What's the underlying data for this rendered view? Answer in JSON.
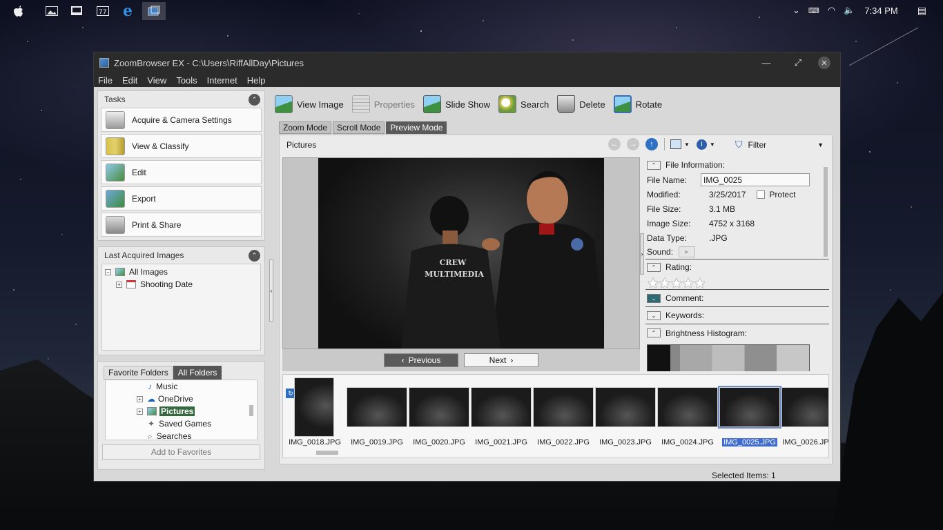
{
  "taskbar": {
    "icons": [
      "apple-icon",
      "photos-icon",
      "computer-icon",
      "calculator-icon",
      "edge-icon",
      "zoombrowser-icon"
    ],
    "time": "7:34 PM"
  },
  "window": {
    "title": "ZoomBrowser EX  -  C:\\Users\\RiffAllDay\\Pictures",
    "menu": [
      "File",
      "Edit",
      "View",
      "Tools",
      "Internet",
      "Help"
    ]
  },
  "tasks": {
    "header": "Tasks",
    "items": [
      "Acquire & Camera Settings",
      "View & Classify",
      "Edit",
      "Export",
      "Print & Share"
    ]
  },
  "last_acquired": {
    "header": "Last Acquired Images",
    "tree": [
      "All Images",
      "Shooting Date"
    ]
  },
  "folders": {
    "tabs": [
      "Favorite Folders",
      "All Folders"
    ],
    "items": [
      "Music",
      "OneDrive",
      "Pictures",
      "Saved Games",
      "Searches"
    ],
    "add_button": "Add to Favorites"
  },
  "toolbar": {
    "items": [
      "View Image",
      "Properties",
      "Slide Show",
      "Search",
      "Delete",
      "Rotate"
    ]
  },
  "mode_tabs": [
    "Zoom Mode",
    "Scroll Mode",
    "Preview Mode"
  ],
  "content": {
    "folder_label": "Pictures",
    "filter_label": "Filter",
    "previous": "Previous",
    "next": "Next"
  },
  "photo": {
    "shirt_text_line1": "CREW",
    "shirt_text_line2": "MULTIMEDIA"
  },
  "file_info": {
    "section_title": "File Information:",
    "file_name_label": "File Name:",
    "file_name": "IMG_0025",
    "modified_label": "Modified:",
    "modified": "3/25/2017",
    "protect_label": "Protect",
    "size_label": "File Size:",
    "size": "3.1 MB",
    "image_size_label": "Image Size:",
    "image_size": "4752 x 3168",
    "data_type_label": "Data Type:",
    "data_type": ".JPG",
    "sound_label": "Sound:",
    "rating_label": "Rating:",
    "rating_stars": "★★★★★",
    "comment_label": "Comment:",
    "keywords_label": "Keywords:",
    "histogram_label": "Brightness Histogram:"
  },
  "thumbnails": [
    "IMG_0018.JPG",
    "IMG_0019.JPG",
    "IMG_0020.JPG",
    "IMG_0021.JPG",
    "IMG_0022.JPG",
    "IMG_0023.JPG",
    "IMG_0024.JPG",
    "IMG_0025.JPG",
    "IMG_0026.JP"
  ],
  "status": {
    "selected": "Selected Items: 1"
  }
}
